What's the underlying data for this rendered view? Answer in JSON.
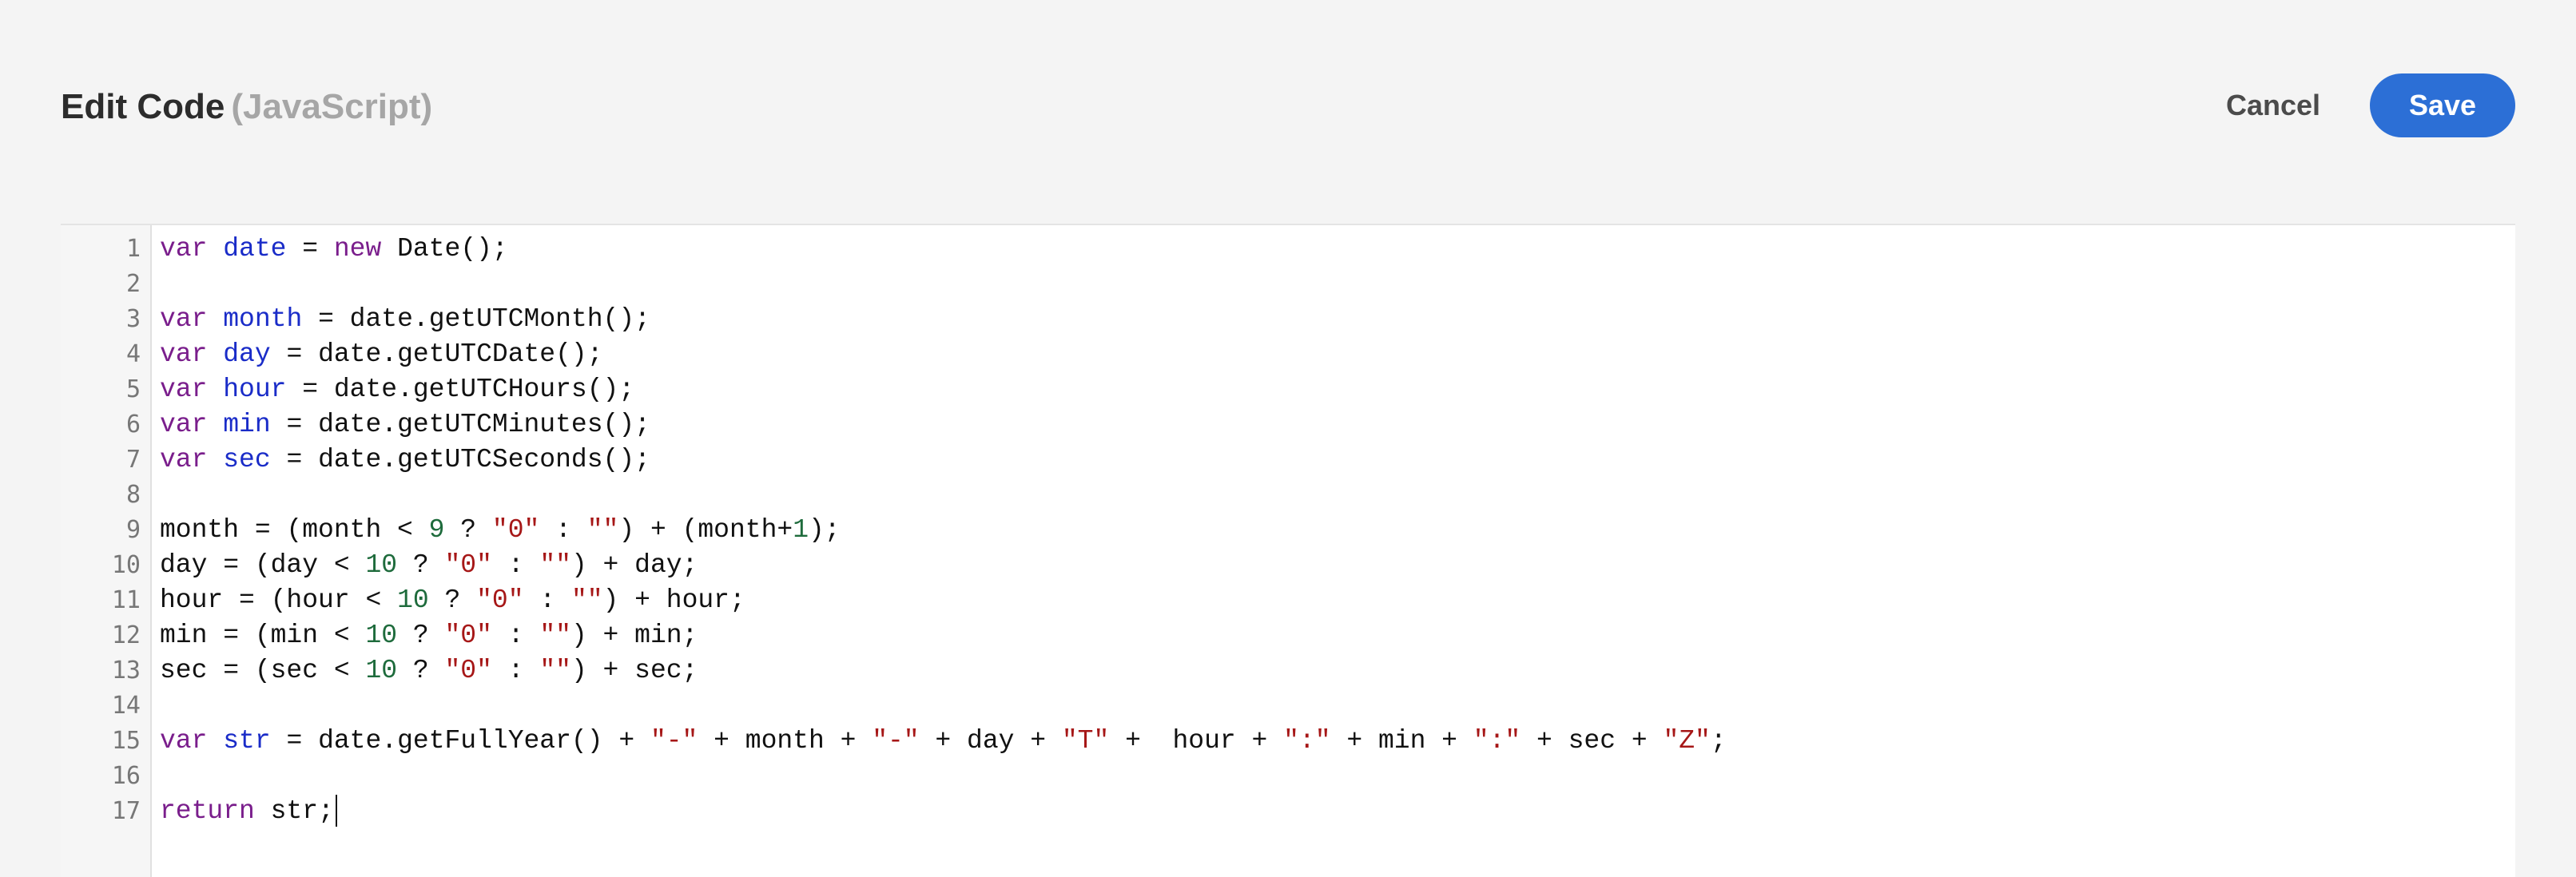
{
  "header": {
    "title": "Edit Code",
    "language": "(JavaScript)",
    "cancel_label": "Cancel",
    "save_label": "Save"
  },
  "colors": {
    "keyword": "#7a1e8c",
    "variable_def": "#1a2cc8",
    "number": "#1e6b3c",
    "string": "#a61717",
    "save_button": "#2c6fd6"
  },
  "editor": {
    "lines": [
      {
        "n": "1",
        "tokens": [
          [
            "kw",
            "var"
          ],
          [
            "t",
            " "
          ],
          [
            "def",
            "date"
          ],
          [
            "t",
            " = "
          ],
          [
            "kw",
            "new"
          ],
          [
            "t",
            " Date();"
          ]
        ]
      },
      {
        "n": "2",
        "tokens": []
      },
      {
        "n": "3",
        "tokens": [
          [
            "kw",
            "var"
          ],
          [
            "t",
            " "
          ],
          [
            "def",
            "month"
          ],
          [
            "t",
            " = date.getUTCMonth();"
          ]
        ]
      },
      {
        "n": "4",
        "tokens": [
          [
            "kw",
            "var"
          ],
          [
            "t",
            " "
          ],
          [
            "def",
            "day"
          ],
          [
            "t",
            " = date.getUTCDate();"
          ]
        ]
      },
      {
        "n": "5",
        "tokens": [
          [
            "kw",
            "var"
          ],
          [
            "t",
            " "
          ],
          [
            "def",
            "hour"
          ],
          [
            "t",
            " = date.getUTCHours();"
          ]
        ]
      },
      {
        "n": "6",
        "tokens": [
          [
            "kw",
            "var"
          ],
          [
            "t",
            " "
          ],
          [
            "def",
            "min"
          ],
          [
            "t",
            " = date.getUTCMinutes();"
          ]
        ]
      },
      {
        "n": "7",
        "tokens": [
          [
            "kw",
            "var"
          ],
          [
            "t",
            " "
          ],
          [
            "def",
            "sec"
          ],
          [
            "t",
            " = date.getUTCSeconds();"
          ]
        ]
      },
      {
        "n": "8",
        "tokens": []
      },
      {
        "n": "9",
        "tokens": [
          [
            "t",
            "month = (month < "
          ],
          [
            "num",
            "9"
          ],
          [
            "t",
            " ? "
          ],
          [
            "str",
            "\"0\""
          ],
          [
            "t",
            " : "
          ],
          [
            "str",
            "\"\""
          ],
          [
            "t",
            ") + (month+"
          ],
          [
            "num",
            "1"
          ],
          [
            "t",
            ");"
          ]
        ]
      },
      {
        "n": "10",
        "tokens": [
          [
            "t",
            "day = (day < "
          ],
          [
            "num",
            "10"
          ],
          [
            "t",
            " ? "
          ],
          [
            "str",
            "\"0\""
          ],
          [
            "t",
            " : "
          ],
          [
            "str",
            "\"\""
          ],
          [
            "t",
            ") + day;"
          ]
        ]
      },
      {
        "n": "11",
        "tokens": [
          [
            "t",
            "hour = (hour < "
          ],
          [
            "num",
            "10"
          ],
          [
            "t",
            " ? "
          ],
          [
            "str",
            "\"0\""
          ],
          [
            "t",
            " : "
          ],
          [
            "str",
            "\"\""
          ],
          [
            "t",
            ") + hour;"
          ]
        ]
      },
      {
        "n": "12",
        "tokens": [
          [
            "t",
            "min = (min < "
          ],
          [
            "num",
            "10"
          ],
          [
            "t",
            " ? "
          ],
          [
            "str",
            "\"0\""
          ],
          [
            "t",
            " : "
          ],
          [
            "str",
            "\"\""
          ],
          [
            "t",
            ") + min;"
          ]
        ]
      },
      {
        "n": "13",
        "tokens": [
          [
            "t",
            "sec = (sec < "
          ],
          [
            "num",
            "10"
          ],
          [
            "t",
            " ? "
          ],
          [
            "str",
            "\"0\""
          ],
          [
            "t",
            " : "
          ],
          [
            "str",
            "\"\""
          ],
          [
            "t",
            ") + sec;"
          ]
        ]
      },
      {
        "n": "14",
        "tokens": []
      },
      {
        "n": "15",
        "tokens": [
          [
            "kw",
            "var"
          ],
          [
            "t",
            " "
          ],
          [
            "def",
            "str"
          ],
          [
            "t",
            " = date.getFullYear() + "
          ],
          [
            "str",
            "\"-\""
          ],
          [
            "t",
            " + month + "
          ],
          [
            "str",
            "\"-\""
          ],
          [
            "t",
            " + day + "
          ],
          [
            "str",
            "\"T\""
          ],
          [
            "t",
            " +  hour + "
          ],
          [
            "str",
            "\":\""
          ],
          [
            "t",
            " + min + "
          ],
          [
            "str",
            "\":\""
          ],
          [
            "t",
            " + sec + "
          ],
          [
            "str",
            "\"Z\""
          ],
          [
            "t",
            ";"
          ]
        ]
      },
      {
        "n": "16",
        "tokens": []
      },
      {
        "n": "17",
        "tokens": [
          [
            "kw",
            "return"
          ],
          [
            "t",
            " str;"
          ]
        ]
      }
    ]
  }
}
